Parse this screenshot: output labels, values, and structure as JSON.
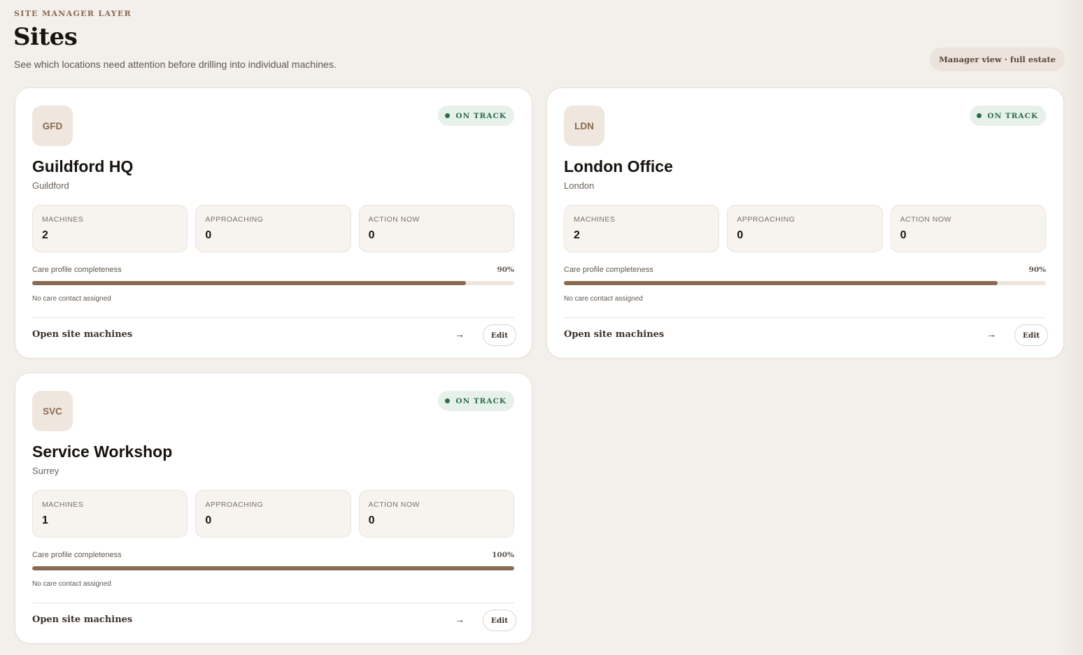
{
  "header": {
    "eyebrow": "SITE MANAGER LAYER",
    "title": "Sites",
    "subtitle": "See which locations need attention before drilling into individual machines.",
    "view_badge": "Manager view · full estate"
  },
  "colors": {
    "background": "#f3f0eb",
    "accent": "#8a6a52",
    "status_on_track": "#2f6b4c",
    "status_on_track_bg": "#e6f1ea"
  },
  "sites": [
    {
      "code": "GFD",
      "status": "ON TRACK",
      "name": "Guildford HQ",
      "location": "Guildford",
      "stats": [
        {
          "label": "MACHINES",
          "value": "2"
        },
        {
          "label": "APPROACHING",
          "value": "0"
        },
        {
          "label": "ACTION NOW",
          "value": "0"
        }
      ],
      "care_label": "Care profile completeness",
      "care_percent_text": "90%",
      "care_fraction": 0.9,
      "contact": "No care contact assigned",
      "open_label": "Open site machines",
      "arrow": "→",
      "edit_label": "Edit"
    },
    {
      "code": "LDN",
      "status": "ON TRACK",
      "name": "London Office",
      "location": "London",
      "stats": [
        {
          "label": "MACHINES",
          "value": "2"
        },
        {
          "label": "APPROACHING",
          "value": "0"
        },
        {
          "label": "ACTION NOW",
          "value": "0"
        }
      ],
      "care_label": "Care profile completeness",
      "care_percent_text": "90%",
      "care_fraction": 0.9,
      "contact": "No care contact assigned",
      "open_label": "Open site machines",
      "arrow": "→",
      "edit_label": "Edit"
    },
    {
      "code": "SVC",
      "status": "ON TRACK",
      "name": "Service Workshop",
      "location": "Surrey",
      "stats": [
        {
          "label": "MACHINES",
          "value": "1"
        },
        {
          "label": "APPROACHING",
          "value": "0"
        },
        {
          "label": "ACTION NOW",
          "value": "0"
        }
      ],
      "care_label": "Care profile completeness",
      "care_percent_text": "100%",
      "care_fraction": 1.0,
      "contact": "No care contact assigned",
      "open_label": "Open site machines",
      "arrow": "→",
      "edit_label": "Edit"
    }
  ]
}
